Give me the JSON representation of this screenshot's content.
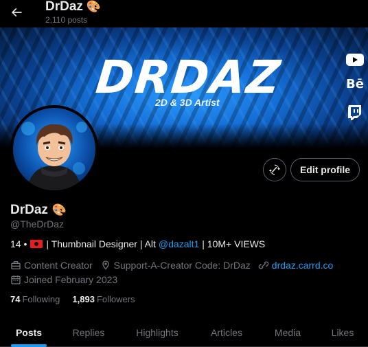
{
  "header": {
    "title": "DrDaz",
    "emoji": "🎨",
    "post_count": "2,110 posts"
  },
  "banner": {
    "brand_text": "DRDAZ",
    "tagline": "2D & 3D Artist",
    "social_icons": [
      "youtube-icon",
      "behance-icon",
      "twitch-icon"
    ],
    "behance_text": "Bē"
  },
  "actions": {
    "edit_profile_label": "Edit profile"
  },
  "profile": {
    "name": "DrDaz",
    "name_emoji": "🎨",
    "handle": "@TheDrDaz",
    "bio": {
      "prefix": "14 •",
      "middle": "| Thumbnail Designer | Alt",
      "alt_link": "@dazalt1",
      "suffix": "| 10M+ VIEWS"
    },
    "category": "Content Creator",
    "creator_code": "Support-A-Creator Code: DrDaz",
    "website": "drdaz.carrd.co",
    "joined": "Joined February 2023",
    "following_count": "74",
    "following_label": "Following",
    "followers_count": "1,893",
    "followers_label": "Followers"
  },
  "tabs": [
    {
      "label": "Posts",
      "active": true
    },
    {
      "label": "Replies",
      "active": false
    },
    {
      "label": "Highlights",
      "active": false
    },
    {
      "label": "Articles",
      "active": false
    },
    {
      "label": "Media",
      "active": false
    },
    {
      "label": "Likes",
      "active": false
    }
  ],
  "colors": {
    "accent": "#1d9bf0",
    "background": "#000000",
    "text": "#e7e9ea",
    "muted": "#71767b"
  }
}
